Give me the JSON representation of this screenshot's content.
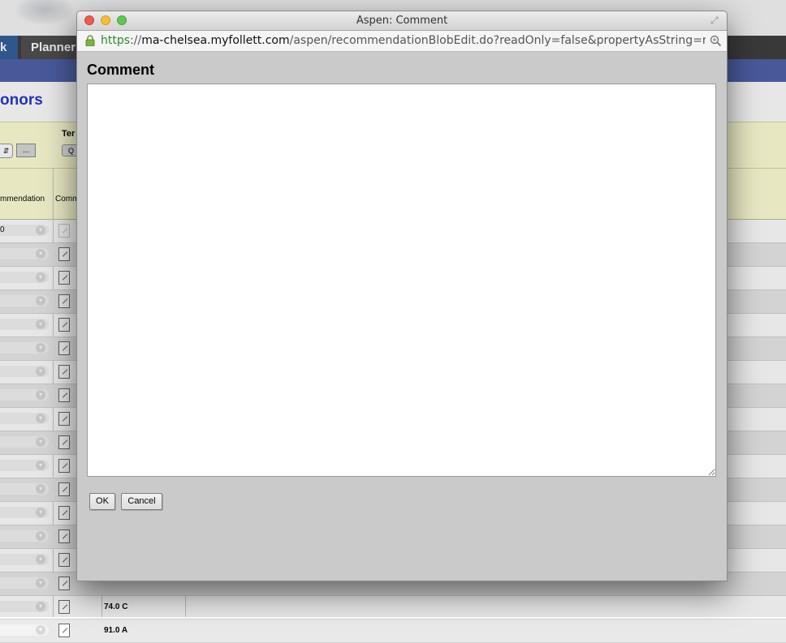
{
  "background": {
    "nav_tab_partial": "k",
    "nav_tab_planner": "Planner",
    "page_title_partial": "onors",
    "filter_dots": "...",
    "filter_label_partial": "Ter",
    "filter_button_partial": "Q",
    "col_recommendation_partial": "mmendation",
    "col_comment_partial": "Comm",
    "first_row_value_partial": "0",
    "rows": [
      {
        "grade": ""
      },
      {
        "grade": ""
      },
      {
        "grade": ""
      },
      {
        "grade": ""
      },
      {
        "grade": ""
      },
      {
        "grade": ""
      },
      {
        "grade": ""
      },
      {
        "grade": ""
      },
      {
        "grade": ""
      },
      {
        "grade": ""
      },
      {
        "grade": ""
      },
      {
        "grade": ""
      },
      {
        "grade": ""
      },
      {
        "grade": ""
      },
      {
        "grade": ""
      },
      {
        "grade": ""
      },
      {
        "grade": "74.0 C"
      },
      {
        "grade": "91.0 A"
      }
    ]
  },
  "window": {
    "title": "Aspen: Comment",
    "url_scheme": "https",
    "url_sep": "://",
    "url_host": "ma-chelsea.myfollett.com",
    "url_path": "/aspen/recommendationBlobEdit.do?readOnly=false&propertyAsString=r..."
  },
  "dialog": {
    "heading": "Comment",
    "comment_value": "",
    "ok_label": "OK",
    "cancel_label": "Cancel"
  }
}
